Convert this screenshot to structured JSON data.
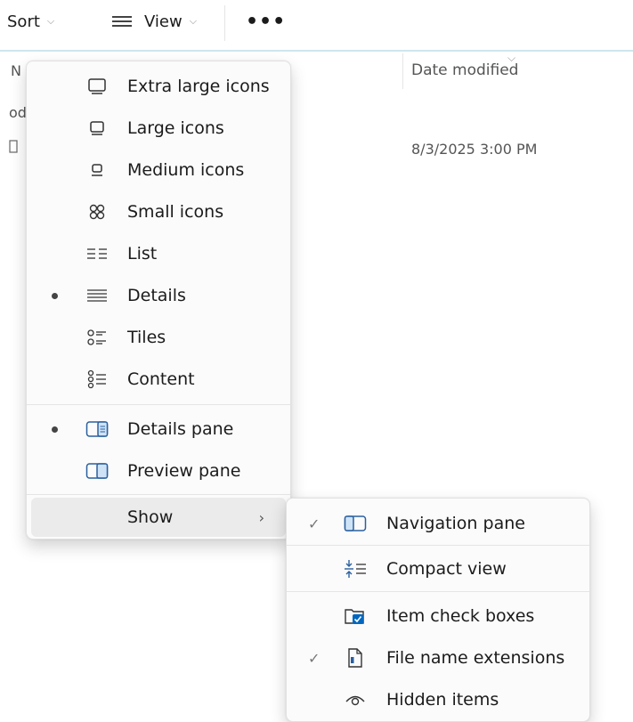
{
  "toolbar": {
    "sort_label": "Sort",
    "view_label": "View",
    "more_label": "•••"
  },
  "file_list": {
    "column_date": "Date modified",
    "row_date": "8/3/2025 3:00 PM",
    "fragment_name": "N",
    "fragment_row": "od"
  },
  "view_menu": {
    "layout_items": [
      {
        "label": "Extra large icons",
        "icon": "monitor-xl-icon"
      },
      {
        "label": "Large icons",
        "icon": "monitor-l-icon"
      },
      {
        "label": "Medium icons",
        "icon": "monitor-m-icon"
      },
      {
        "label": "Small icons",
        "icon": "grid-icon"
      },
      {
        "label": "List",
        "icon": "list-columns-icon"
      },
      {
        "label": "Details",
        "icon": "details-lines-icon",
        "selected": true
      },
      {
        "label": "Tiles",
        "icon": "tiles-icon"
      },
      {
        "label": "Content",
        "icon": "content-icon"
      }
    ],
    "pane_items": [
      {
        "label": "Details pane",
        "icon": "details-pane-icon",
        "selected": true
      },
      {
        "label": "Preview pane",
        "icon": "preview-pane-icon"
      }
    ],
    "show_label": "Show"
  },
  "show_menu": {
    "items": [
      {
        "label": "Navigation pane",
        "icon": "navigation-pane-icon",
        "checked": true
      },
      {
        "label": "Compact view",
        "icon": "compact-view-icon"
      },
      {
        "label": "Item check boxes",
        "icon": "item-checkbox-icon"
      },
      {
        "label": "File name extensions",
        "icon": "file-extension-icon",
        "checked": true
      },
      {
        "label": "Hidden items",
        "icon": "eye-icon"
      }
    ]
  },
  "colors": {
    "accent": "#0067c0",
    "menu_bg": "#fbfbfb",
    "hover_bg": "#ebebeb",
    "toolbar_line": "#cfe6ec"
  }
}
